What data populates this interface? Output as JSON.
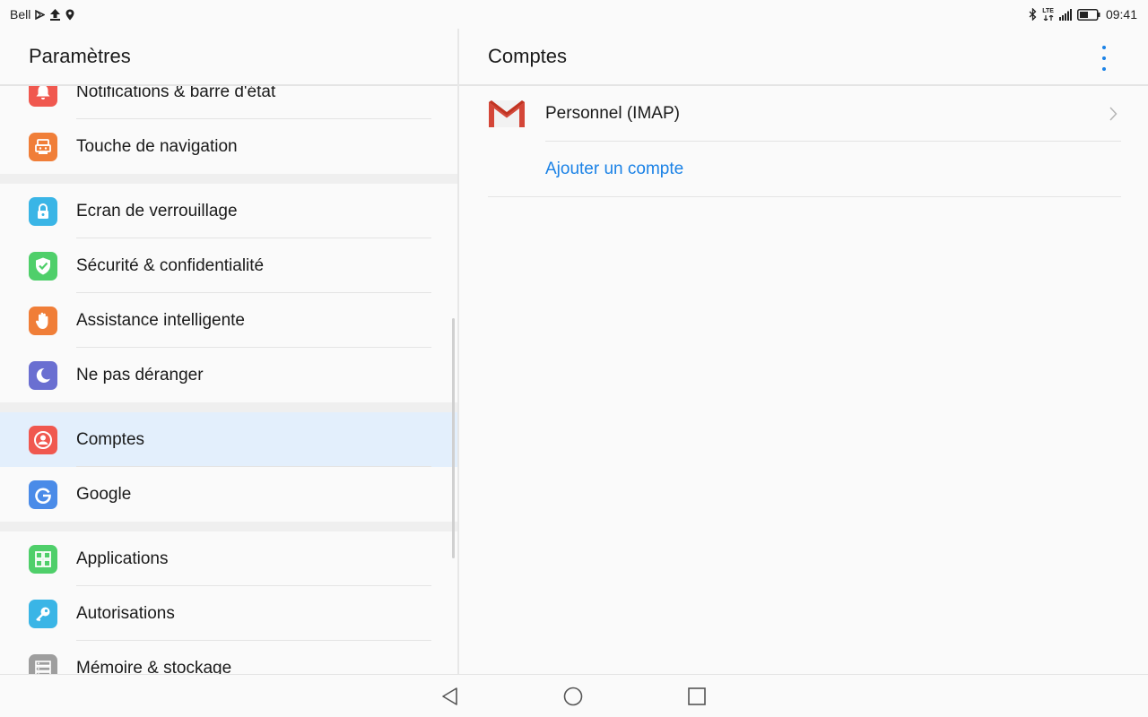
{
  "status_bar": {
    "carrier": "Bell",
    "network": "LTE",
    "time": "09:41"
  },
  "left_panel": {
    "title": "Paramètres",
    "items": [
      {
        "label": "Notifications & barre d'état",
        "icon": "bell-icon",
        "color": "#f0584f"
      },
      {
        "label": "Touche de navigation",
        "icon": "navigation-key-icon",
        "color": "#f07e38"
      },
      {
        "label": "Ecran de verrouillage",
        "icon": "lock-icon",
        "color": "#3ab5e6"
      },
      {
        "label": "Sécurité & confidentialité",
        "icon": "shield-check-icon",
        "color": "#4fcf6a"
      },
      {
        "label": "Assistance intelligente",
        "icon": "hand-icon",
        "color": "#f07e38"
      },
      {
        "label": "Ne pas déranger",
        "icon": "moon-icon",
        "color": "#6a6fd1"
      },
      {
        "label": "Comptes",
        "icon": "account-icon",
        "color": "#f0584f",
        "selected": true
      },
      {
        "label": "Google",
        "icon": "google-icon",
        "color": "#4a8be8"
      },
      {
        "label": "Applications",
        "icon": "apps-grid-icon",
        "color": "#4fcf6a"
      },
      {
        "label": "Autorisations",
        "icon": "key-icon",
        "color": "#3ab5e6"
      },
      {
        "label": "Mémoire & stockage",
        "icon": "storage-icon",
        "color": "#9e9e9e"
      }
    ]
  },
  "right_panel": {
    "title": "Comptes",
    "accounts": [
      {
        "label": "Personnel (IMAP)",
        "icon": "gmail-icon"
      }
    ],
    "add_account_label": "Ajouter un compte"
  },
  "colors": {
    "accent": "#1b82e6",
    "selected_row": "#e3effc"
  }
}
